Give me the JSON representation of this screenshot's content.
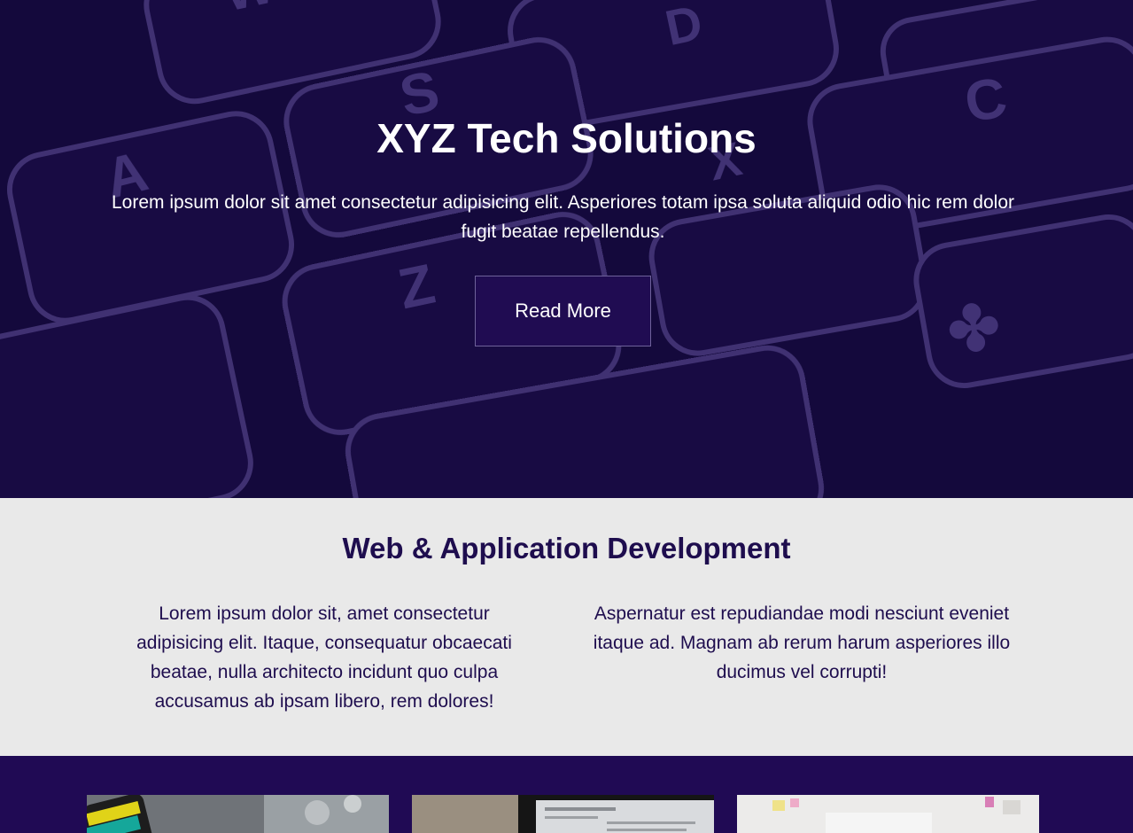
{
  "hero": {
    "title": "XYZ Tech Solutions",
    "text": "Lorem ipsum dolor sit amet consectetur adipisicing elit. Asperiores totam ipsa soluta aliquid odio hic rem dolor fugit beatae repellendus.",
    "button_label": "Read More",
    "key_letters": [
      "W",
      "D",
      "S",
      "A",
      "C",
      "X",
      "Z"
    ]
  },
  "services": {
    "title": "Web & Application Development",
    "col_left": "Lorem ipsum dolor sit, amet consectetur adipisicing elit. Itaque, consequatur obcaecati beatae, nulla architecto incidunt quo culpa accusamus ab ipsam libero, rem dolores!",
    "col_right": "Aspernatur est repudiandae modi nesciunt eveniet itaque ad. Magnam ab rerum harum asperiores illo ducimus vel corrupti!"
  },
  "gallery": {
    "items": [
      "phone-photo",
      "laptop-photo",
      "office-photo"
    ]
  },
  "colors": {
    "hero_bg": "#160a3f",
    "key_highlight": "#6b59a8",
    "button_bg": "#200c52",
    "services_bg": "#e9e9e9",
    "services_text": "#1e0d4e",
    "gallery_bg": "#200a54"
  }
}
